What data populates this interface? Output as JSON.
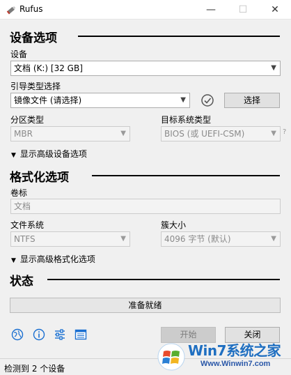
{
  "window": {
    "title": "Rufus"
  },
  "titlebar": {
    "min_glyph": "—",
    "max_glyph": "☐",
    "close_glyph": "✕"
  },
  "device_section": {
    "title": "设备选项",
    "device_label": "设备",
    "device_value": "文档 (K:) [32 GB]",
    "boot_label": "引导类型选择",
    "boot_value": "镜像文件 (请选择)",
    "select_button": "选择",
    "partition_label": "分区类型",
    "partition_value": "MBR",
    "target_label": "目标系统类型",
    "target_value": "BIOS (或 UEFI-CSM)",
    "target_help": "?",
    "advanced_toggle": "显示高级设备选项"
  },
  "format_section": {
    "title": "格式化选项",
    "volume_label": "卷标",
    "volume_value": "文档",
    "fs_label": "文件系统",
    "fs_value": "NTFS",
    "cluster_label": "簇大小",
    "cluster_value": "4096 字节 (默认)",
    "advanced_toggle": "显示高级格式化选项"
  },
  "status_section": {
    "title": "状态",
    "progress_text": "准备就绪"
  },
  "actions": {
    "start_button": "开始",
    "close_button": "关闭"
  },
  "statusbar": {
    "text": "检测到 2 个设备"
  },
  "watermark": {
    "line1": "Win7系统之家",
    "line2": "Www.Winwin7.com"
  },
  "icons": [
    "language-icon",
    "info-icon",
    "settings-icon",
    "log-icon",
    "check-icon"
  ],
  "colors": {
    "accent": "#1a6fd1",
    "watermark": "#1f6fc1"
  }
}
